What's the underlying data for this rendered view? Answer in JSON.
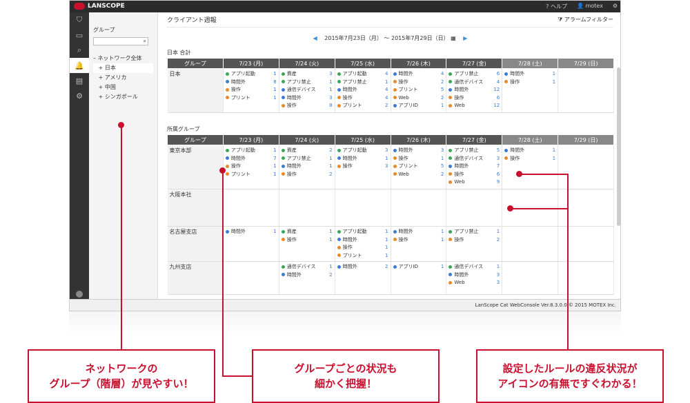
{
  "app": {
    "logo": "LANSCOPE",
    "help": "ヘルプ",
    "user": "motex"
  },
  "sidebar": {
    "label": "グループ",
    "tree": [
      "ネットワーク全体",
      "日本",
      "アメリカ",
      "中国",
      "シンガポール"
    ]
  },
  "main": {
    "title": "クライアント週報",
    "filter": "アラームフィルター",
    "date_range": "2015年7月23日（月） ～ 2015年7月29日（日）"
  },
  "table1": {
    "title": "日本 合計"
  },
  "table2": {
    "title": "所属グループ"
  },
  "headers": [
    "グループ",
    "7/23 (月)",
    "7/24 (火)",
    "7/25 (水)",
    "7/26 (木)",
    "7/27 (金)",
    "7/28 (土)",
    "7/29 (日)"
  ],
  "footer": "LanScope Cat WebConsole Ver.8.3.0.0 © 2015 MOTEX Inc.",
  "callouts": {
    "c1": "ネットワークの\nグループ（階層）が見やすい！",
    "c2": "グループごとの状況も\n細かく把握！",
    "c3": "設定したルールの違反状況が\nアイコンの有無ですぐわかる！"
  }
}
